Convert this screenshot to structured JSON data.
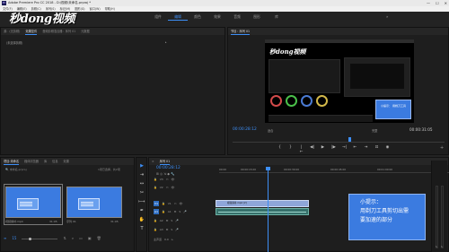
{
  "titlebar": {
    "app_icon": "Pr",
    "title": "Adobe Premiere Pro CC 2018 - D:\\视频\\未命名.prproj *",
    "controls": [
      "—",
      "☐",
      "✕"
    ]
  },
  "menubar": [
    "文件(F)",
    "编辑(E)",
    "剪辑(C)",
    "序列(S)",
    "标记(M)",
    "图形(G)",
    "窗口(W)",
    "帮助(H)"
  ],
  "watermark": "秒dong视频",
  "workspaces": {
    "tabs": [
      "组件",
      "编辑",
      "颜色",
      "效果",
      "音频",
      "图形",
      "库"
    ],
    "active": 1,
    "more": "»"
  },
  "effect_controls": {
    "tabs": [
      "源：(无剪辑)",
      "效果控件",
      "音频剪辑混合器：序列 01",
      "元数据"
    ],
    "active": 1,
    "empty_text": "(未选择剪辑)"
  },
  "program_monitor": {
    "tab": "节目：序列 01",
    "inner_logo": "秒dong视频",
    "inner_info": "小提示：\n用剃刀工具",
    "timecode_current": "00:00:28:12",
    "fit_label": "适合",
    "quality_label": "完整",
    "timecode_total": "00:00:31:05",
    "transport": [
      "{",
      "}",
      "|←",
      "◀|",
      "▶",
      "|▶",
      "→|",
      "⇤",
      "⇥",
      "⊡",
      "◉"
    ],
    "add_button": "+"
  },
  "project": {
    "tabs": [
      "项目:未命名",
      "媒体浏览器",
      "库",
      "信息",
      "效果"
    ],
    "active": 0,
    "search_placeholder": "🔍 未命名.prproj",
    "item_count": "1项已选择，共2项",
    "items": [
      {
        "name": "视频素材.mp4",
        "duration": "31:05"
      },
      {
        "name": "序列 01",
        "duration": "31:05"
      }
    ],
    "zoom_value": "15"
  },
  "tools": {
    "icons": [
      "▶",
      "⇥",
      "↔",
      "✂",
      "⟼",
      "✒",
      "✋",
      "T"
    ],
    "active": 3,
    "tooltip": "剃刀工具 (C)"
  },
  "timeline": {
    "tab": "序列 01",
    "timecode": "00:00:28:12",
    "ruler_marks": [
      "00:00",
      "00:00:15:00",
      "00:00:30:00",
      "00:00:45:00",
      "00:01:00:00"
    ],
    "tracks": [
      {
        "id": "V3",
        "kind": "video"
      },
      {
        "id": "V2",
        "kind": "video"
      },
      {
        "id": "V1",
        "kind": "video",
        "target": "V1"
      },
      {
        "id": "A1",
        "kind": "audio",
        "target": "A1"
      },
      {
        "id": "A2",
        "kind": "audio"
      },
      {
        "id": "A3",
        "kind": "audio"
      }
    ],
    "master": "主声道",
    "master_value": "0.0",
    "video_clip": "视频素材.mp4 [V]",
    "vu_labels": [
      "S",
      "S"
    ]
  },
  "tip": {
    "title": "小提示：",
    "line1": "用剃刀工具剪切出需",
    "line2": "要加速的部分"
  },
  "colors": {
    "accent": "#3d8ef5",
    "clip_video": "#8fa6d9",
    "clip_audio": "#36706a",
    "tip_bg": "#3b7be0"
  }
}
